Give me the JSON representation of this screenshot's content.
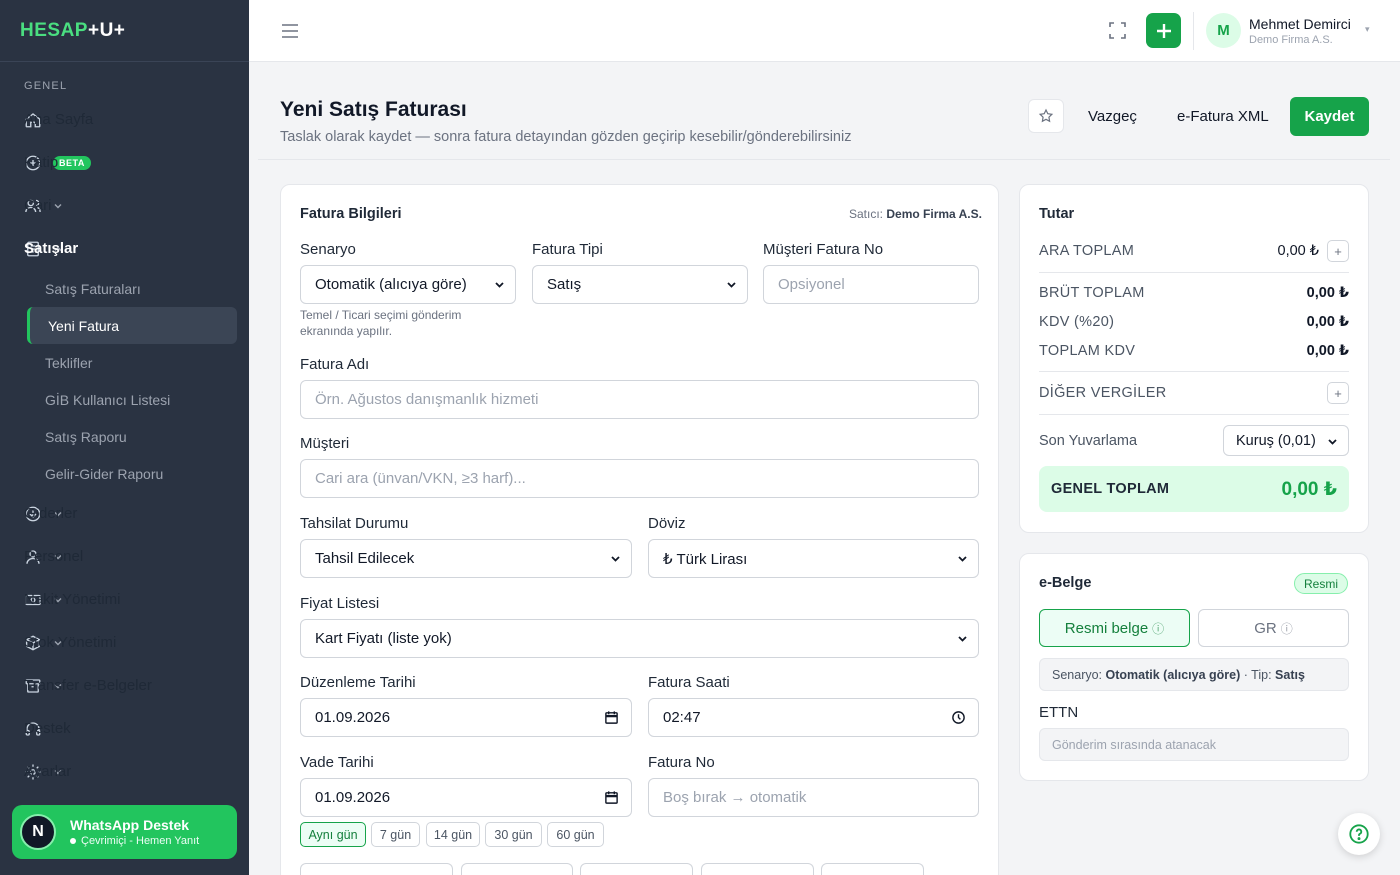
{
  "brand": {
    "part1": "HESAP",
    "part2": "+U+"
  },
  "sidebar": {
    "section": "GENEL",
    "items": [
      {
        "label": "Ana Sayfa"
      },
      {
        "label": "Kâtip",
        "badge": "BETA"
      },
      {
        "label": "Cari"
      },
      {
        "label": "Satışlar"
      },
      {
        "label": "Giderler"
      },
      {
        "label": "Personel"
      },
      {
        "label": "Nakit Yönetimi"
      },
      {
        "label": "Stok Yönetimi"
      },
      {
        "label": "Transfer e-Belgeler"
      },
      {
        "label": "Destek"
      },
      {
        "label": "Ayarlar"
      }
    ],
    "sales_sub": [
      {
        "label": "Satış Faturaları"
      },
      {
        "label": "Yeni Fatura"
      },
      {
        "label": "Teklifler"
      },
      {
        "label": "GİB Kullanıcı Listesi"
      },
      {
        "label": "Satış Raporu"
      },
      {
        "label": "Gelir-Gider Raporu"
      }
    ],
    "whatsapp": {
      "avatar": "N",
      "title": "WhatsApp Destek",
      "status": "Çevrimiçi - Hemen Yanıt"
    }
  },
  "topbar": {
    "user_initial": "M",
    "user_name": "Mehmet Demirci",
    "user_firm": "Demo Firma A.S."
  },
  "header": {
    "title": "Yeni Satış Faturası",
    "subtitle": "Taslak olarak kaydet — sonra fatura detayından gözden geçirip kesebilir/gönderebilirsiniz",
    "cancel": "Vazgeç",
    "xml": "e-Fatura XML",
    "save": "Kaydet"
  },
  "form": {
    "section_title": "Fatura Bilgileri",
    "seller_label": "Satıcı:",
    "seller_value": "Demo Firma A.S.",
    "scenario_label": "Senaryo",
    "scenario_value": "Otomatik (alıcıya göre)",
    "scenario_hint": "Temel / Ticari seçimi gönderim ekranında yapılır.",
    "type_label": "Fatura Tipi",
    "type_value": "Satış",
    "custno_label": "Müşteri Fatura No",
    "custno_placeholder": "Opsiyonel",
    "name_label": "Fatura Adı",
    "name_placeholder": "Örn. Ağustos danışmanlık hizmeti",
    "customer_label": "Müşteri",
    "customer_placeholder": "Cari ara (ünvan/VKN, ≥3 harf)...",
    "collection_label": "Tahsilat Durumu",
    "collection_value": "Tahsil Edilecek",
    "currency_label": "Döviz",
    "currency_value": "₺ Türk Lirası",
    "pricelist_label": "Fiyat Listesi",
    "pricelist_value": "Kart Fiyatı (liste yok)",
    "issue_date_label": "Düzenleme Tarihi",
    "issue_date_value": "01.09.2026",
    "time_label": "Fatura Saati",
    "time_value": "02:47",
    "due_label": "Vade Tarihi",
    "due_value": "01.09.2026",
    "invno_label": "Fatura No",
    "invno_placeholder": "Boş bırak → otomatik",
    "due_chips": [
      "Aynı gün",
      "7 gün",
      "14 gün",
      "30 gün",
      "60 gün"
    ]
  },
  "totals": {
    "title": "Tutar",
    "subtotal_label": "ARA TOPLAM",
    "subtotal_value": "0,00 ₺",
    "gross_label": "BRÜT TOPLAM",
    "gross_value": "0,00 ₺",
    "vat_label": "KDV (%20)",
    "vat_value": "0,00 ₺",
    "total_vat_label": "TOPLAM KDV",
    "total_vat_value": "0,00 ₺",
    "other_tax_label": "DİĞER VERGİLER",
    "rounding_label": "Son Yuvarlama",
    "rounding_value": "Kuruş (0,01)",
    "grand_label": "GENEL TOPLAM",
    "grand_value": "0,00 ₺"
  },
  "ebelge": {
    "title": "e-Belge",
    "badge": "Resmi",
    "opt1": "Resmi belge",
    "opt2": "GR",
    "info_scenario_label": "Senaryo:",
    "info_scenario_value": "Otomatik (alıcıya göre)",
    "info_type_label": "· Tip:",
    "info_type_value": "Satış",
    "ettn_label": "ETTN",
    "ettn_placeholder": "Gönderim sırasında atanacak"
  },
  "colors": {
    "accent": "#16a34a",
    "sidebar": "#2a3342"
  }
}
